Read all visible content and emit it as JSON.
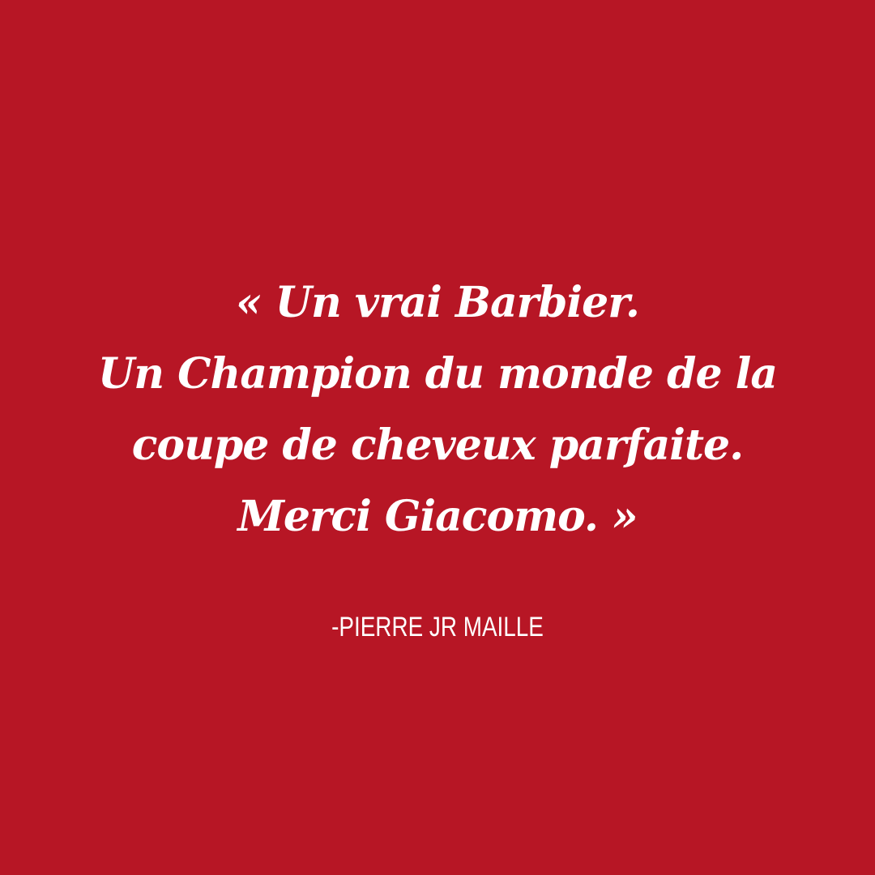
{
  "colors": {
    "background": "#b71625",
    "text": "#ffffff"
  },
  "quote": {
    "lines": [
      "« Un vrai Barbier.",
      "Un Champion du monde de la",
      "coupe de cheveux parfaite.",
      "Merci Giacomo. »"
    ]
  },
  "attribution": "-PIERRE JR MAILLE"
}
